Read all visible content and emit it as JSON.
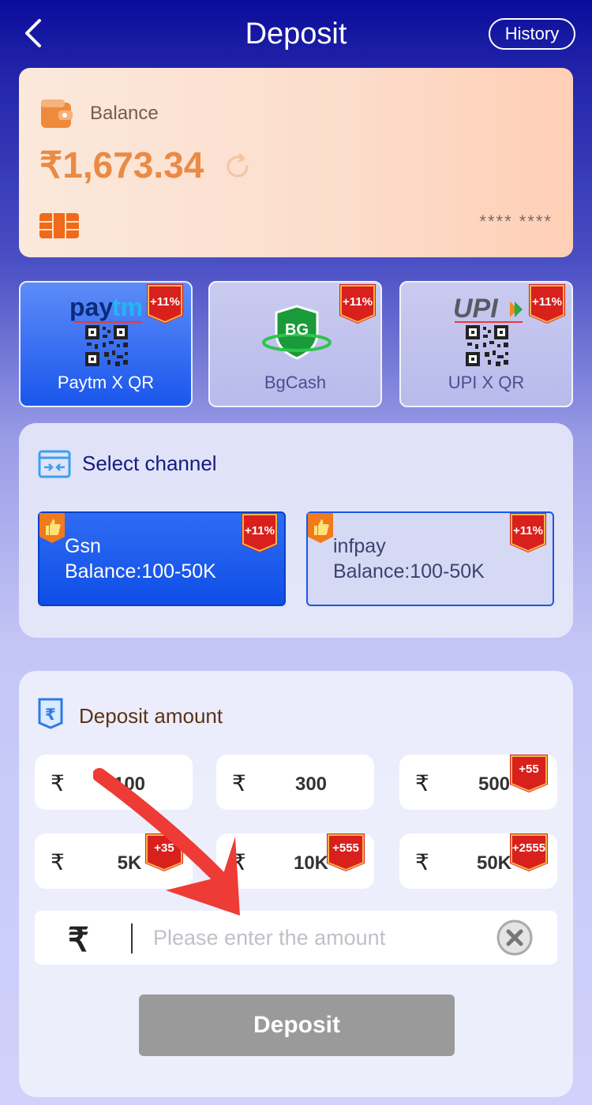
{
  "header": {
    "title": "Deposit",
    "history_label": "History"
  },
  "balance": {
    "label": "Balance",
    "value": "₹1,673.34",
    "card_number": "**** ****"
  },
  "methods": [
    {
      "logo": "paytm",
      "label": "Paytm X QR",
      "bonus": "+11%",
      "selected": true
    },
    {
      "logo": "BG",
      "label": "BgCash",
      "bonus": "+11%",
      "selected": false
    },
    {
      "logo": "UPI",
      "label": "UPI X QR",
      "bonus": "+11%",
      "selected": false
    }
  ],
  "channel_section": {
    "title": "Select channel",
    "channels": [
      {
        "name": "Gsn",
        "range": "Balance:100-50K",
        "bonus": "+11%",
        "selected": true
      },
      {
        "name": "infpay",
        "range": "Balance:100-50K",
        "bonus": "+11%",
        "selected": false
      }
    ]
  },
  "amount_section": {
    "title": "Deposit amount",
    "currency": "₹",
    "options": [
      {
        "value": "100",
        "bonus": ""
      },
      {
        "value": "300",
        "bonus": ""
      },
      {
        "value": "500",
        "bonus": "+55"
      },
      {
        "value": "5K",
        "bonus": "+35"
      },
      {
        "value": "10K",
        "bonus": "+555"
      },
      {
        "value": "50K",
        "bonus": "+2555"
      }
    ],
    "input_placeholder": "Please enter the amount",
    "deposit_label": "Deposit"
  },
  "colors": {
    "accent_blue": "#1a56ec",
    "badge_red": "#d8201c",
    "balance_orange": "#ea8a45",
    "header_navy": "#0a0c9a",
    "button_disabled": "#9a9a9a"
  }
}
